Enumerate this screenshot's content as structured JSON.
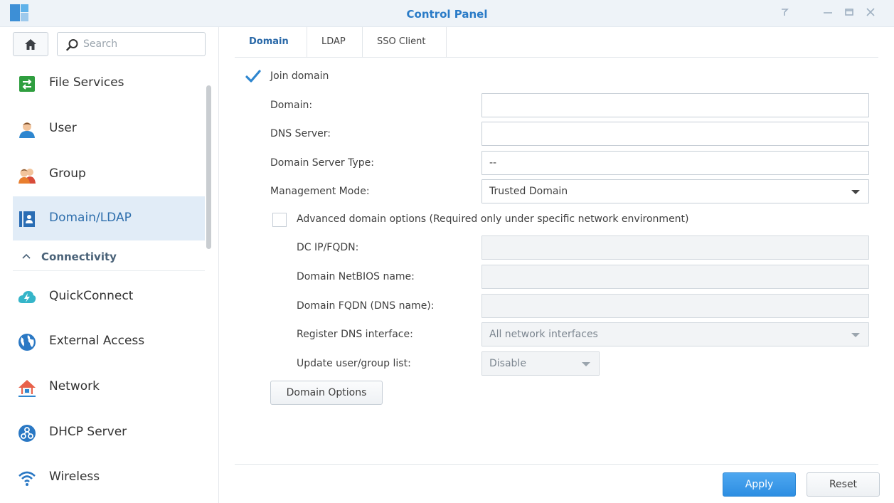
{
  "window": {
    "title": "Control Panel",
    "controls": [
      "pin-icon",
      "minimize-icon",
      "maximize-icon",
      "close-icon"
    ]
  },
  "search": {
    "placeholder": "Search"
  },
  "sidebar": {
    "items": [
      {
        "label": "File Services",
        "icon": "file-services-icon"
      },
      {
        "label": "User",
        "icon": "user-icon"
      },
      {
        "label": "Group",
        "icon": "group-icon"
      },
      {
        "label": "Domain/LDAP",
        "icon": "domain-ldap-icon",
        "active": true
      }
    ],
    "section": {
      "label": "Connectivity"
    },
    "connectivity_items": [
      {
        "label": "QuickConnect",
        "icon": "quickconnect-icon"
      },
      {
        "label": "External Access",
        "icon": "globe-icon"
      },
      {
        "label": "Network",
        "icon": "network-house-icon"
      },
      {
        "label": "DHCP Server",
        "icon": "dhcp-server-icon"
      },
      {
        "label": "Wireless",
        "icon": "wifi-icon"
      }
    ]
  },
  "tabs": [
    {
      "label": "Domain",
      "active": true
    },
    {
      "label": "LDAP"
    },
    {
      "label": "SSO Client"
    }
  ],
  "form": {
    "join_domain": {
      "label": "Join domain",
      "checked": true
    },
    "domain": {
      "label": "Domain:",
      "value": ""
    },
    "dns_server": {
      "label": "DNS Server:",
      "value": ""
    },
    "domain_server_type": {
      "label": "Domain Server Type:",
      "value": "--"
    },
    "management_mode": {
      "label": "Management Mode:",
      "value": "Trusted Domain"
    },
    "advanced": {
      "label": "Advanced domain options (Required only under specific network environment)",
      "checked": false
    },
    "dc_ip": {
      "label": "DC IP/FQDN:",
      "value": ""
    },
    "netbios": {
      "label": "Domain NetBIOS name:",
      "value": ""
    },
    "fqdn": {
      "label": "Domain FQDN (DNS name):",
      "value": ""
    },
    "register_dns": {
      "label": "Register DNS interface:",
      "value": "All network interfaces"
    },
    "update_list": {
      "label": "Update user/group list:",
      "value": "Disable"
    },
    "domain_options_button": "Domain Options"
  },
  "footer": {
    "apply": "Apply",
    "reset": "Reset"
  },
  "colors": {
    "accent": "#2a7bc7",
    "active_bg": "#e1ecf7",
    "primary_button": "#2d8ee2"
  }
}
